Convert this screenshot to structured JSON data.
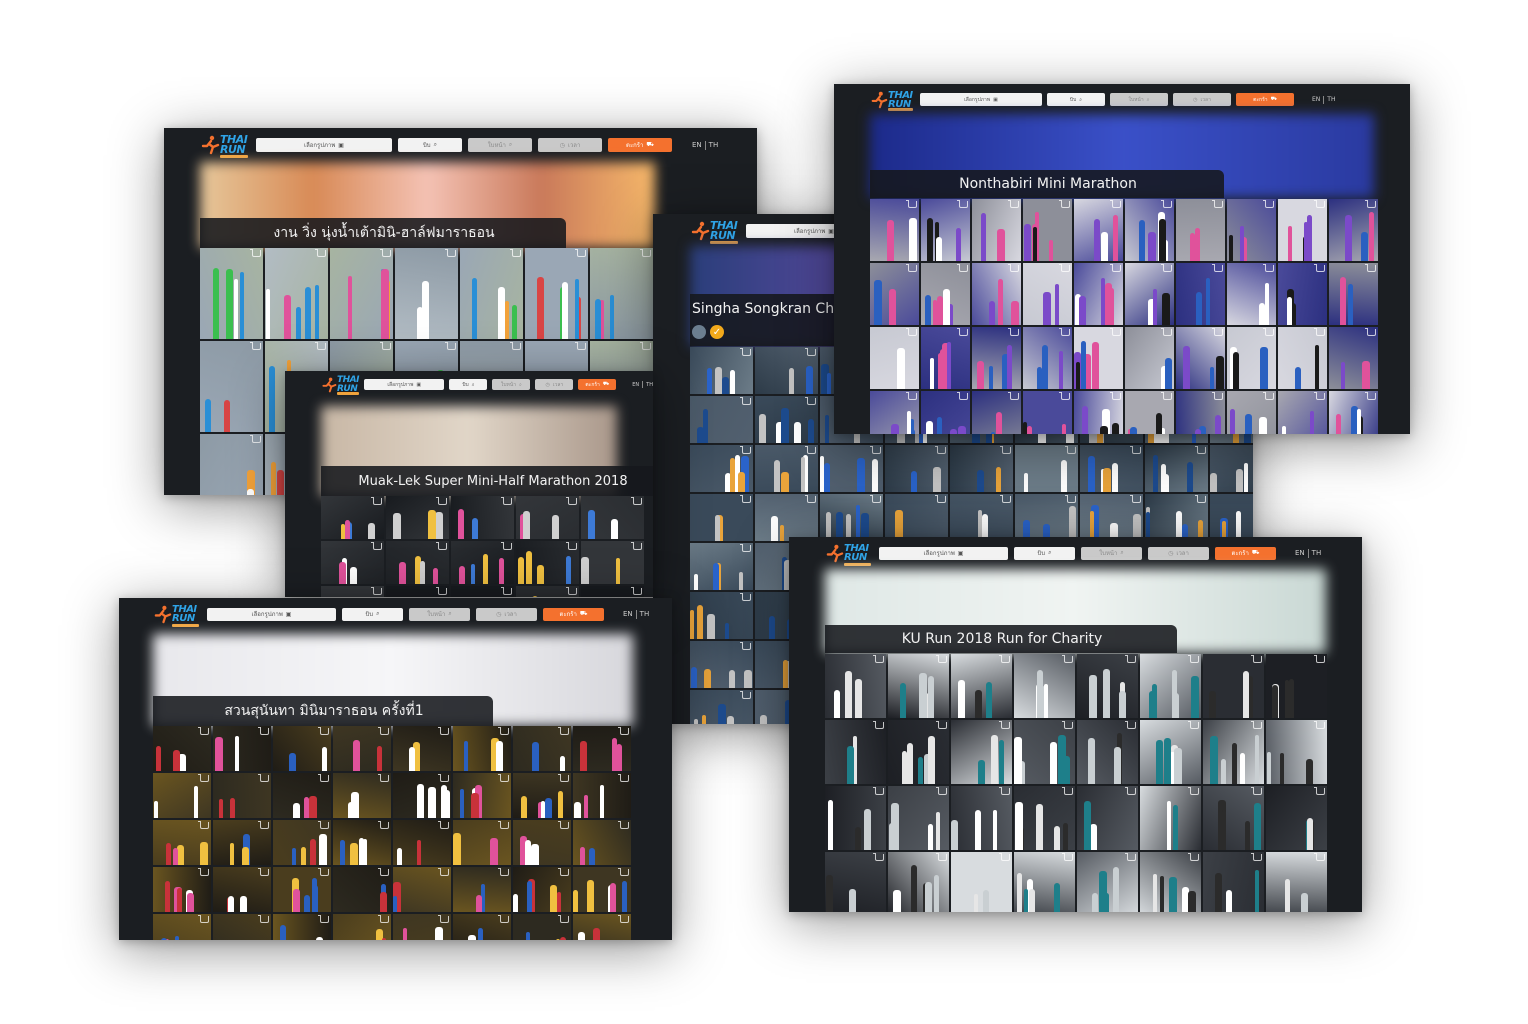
{
  "app": {
    "brand_line1": "THAI",
    "brand_line2": "RUN",
    "search_by_photo": "เลือกรูปภาพ",
    "search_by_bib": "บิบ",
    "search_by_face": "ใบหน้า",
    "search_by_time": "เวลา",
    "cart": "ตะกร้า",
    "lang_en": "EN",
    "lang_th": "TH"
  },
  "screenshots": [
    {
      "id": "nong-nam-tao",
      "event_title": "งาน วิ่ง นุ่งน้ำเต้ามินิ-ฮาล์ฟมาราธอน",
      "hero_colors": [
        "#e6c79a",
        "#d88a56",
        "#f4c2b4",
        "#c9795a",
        "#f6b86a"
      ],
      "photo_palette": "day"
    },
    {
      "id": "singha-songkran",
      "event_title": "Singha Songkran Chia",
      "hero_colors": [
        "#2a3e7a",
        "#5a4aa0",
        "#3b8fb0",
        "#9b4ea8"
      ],
      "photo_palette": "mixed"
    },
    {
      "id": "muak-lek",
      "event_title": "Muak-Lek Super Mini-Half Marathon 2018",
      "hero_colors": [
        "#c8b7a5",
        "#e1d6c8",
        "#a9978a"
      ],
      "photo_palette": "night"
    },
    {
      "id": "nonthaburi",
      "event_title": "Nonthabiri Mini Marathon",
      "hero_colors": [
        "#1c2a8a",
        "#3a50c8",
        "#2a3aa0"
      ],
      "photo_palette": "event"
    },
    {
      "id": "suan-sunantha",
      "event_title": "สวนสุนันทา มินิมาราธอน ครั้งที่1",
      "hero_colors": [
        "#e8e8ec",
        "#f6f6f8",
        "#d7d7dc"
      ],
      "photo_palette": "pinknight"
    },
    {
      "id": "ku-run",
      "event_title": "KU Run 2018 Run for Charity",
      "hero_colors": [
        "#dfe8e6",
        "#f0f4f2",
        "#c9d8d4"
      ],
      "photo_palette": "crowd"
    }
  ]
}
